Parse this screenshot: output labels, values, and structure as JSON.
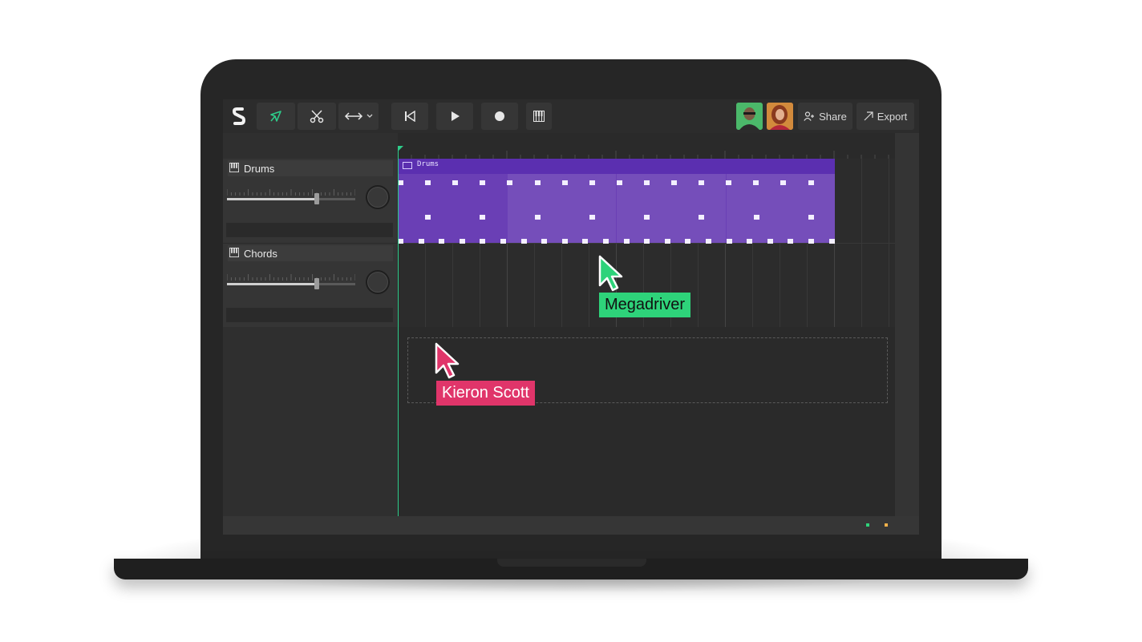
{
  "toolbar": {
    "logo_icon": "logo-s-icon",
    "tools": [
      {
        "name": "pointer-tool",
        "icon": "arrow-pointer-icon",
        "active": true
      },
      {
        "name": "scissors-tool",
        "icon": "scissors-icon",
        "active": false
      },
      {
        "name": "stretch-tool",
        "icon": "horizontal-arrows-icon",
        "has_dropdown": true
      }
    ],
    "transport": [
      {
        "name": "skip-back",
        "icon": "skip-back-icon"
      },
      {
        "name": "play",
        "icon": "play-icon"
      },
      {
        "name": "record",
        "icon": "record-icon"
      },
      {
        "name": "keyboard",
        "icon": "piano-keys-icon"
      }
    ],
    "share_label": "Share",
    "export_label": "Export"
  },
  "collaborators": [
    {
      "name": "Megadriver",
      "color": "#2ed37a"
    },
    {
      "name": "Kieron Scott",
      "color": "#e0356a"
    }
  ],
  "tracks": [
    {
      "name": "Drums",
      "icon": "piano-keys-icon",
      "volume": 0.7
    },
    {
      "name": "Chords",
      "icon": "piano-keys-icon",
      "volume": 0.7
    }
  ],
  "clip": {
    "label": "Drums",
    "color": "#6a3fb5"
  },
  "accent": "#2ecc8a",
  "status_colors": [
    "#2ed37a",
    "#f0b04a"
  ]
}
